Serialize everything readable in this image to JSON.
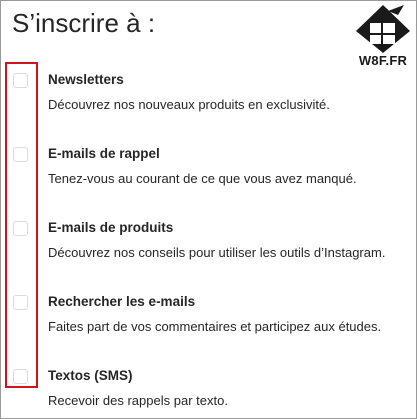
{
  "header": {
    "title": "S’inscrire à :"
  },
  "logo": {
    "text": "W8F.FR",
    "icon": "windows-bird-icon"
  },
  "colors": {
    "highlight": "#d0141e",
    "text": "#262626",
    "checkbox_border": "#dbdbdb"
  },
  "items": [
    {
      "title": "Newsletters",
      "description": "Découvrez nos nouveaux produits en exclusivité.",
      "checked": false
    },
    {
      "title": "E-mails de rappel",
      "description": "Tenez-vous au courant de ce que vous avez manqué.",
      "checked": false
    },
    {
      "title": "E-mails de produits",
      "description": "Découvrez nos conseils pour utiliser les outils d’Instagram.",
      "checked": false
    },
    {
      "title": "Rechercher les e-mails",
      "description": "Faites part de vos commentaires et participez aux études.",
      "checked": false
    },
    {
      "title": "Textos (SMS)",
      "description": "Recevoir des rappels par texto.",
      "checked": false
    }
  ]
}
